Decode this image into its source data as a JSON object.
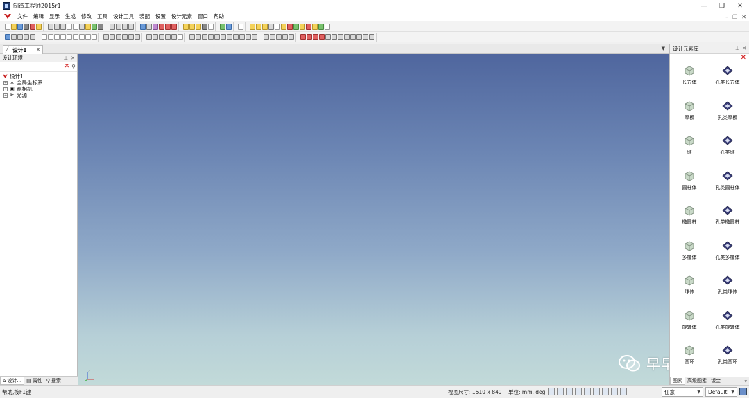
{
  "window": {
    "title": "制造工程师2015r1"
  },
  "menu": {
    "items": [
      "文件",
      "编辑",
      "显示",
      "生成",
      "修改",
      "工具",
      "设计工具",
      "装配",
      "设置",
      "设计元素",
      "窗口",
      "帮助"
    ]
  },
  "document_tab": {
    "label": "设计1"
  },
  "left_panel": {
    "title": "设计环境",
    "tree": [
      {
        "label": "设计1"
      },
      {
        "label": "全局坐标系"
      },
      {
        "label": "照相机"
      },
      {
        "label": "光源"
      }
    ],
    "bottom_tabs": [
      "设计...",
      "属性",
      "搜索"
    ]
  },
  "right_panel": {
    "title": "设计元素库",
    "items": [
      {
        "label": "长方体",
        "icon": "box-icon"
      },
      {
        "label": "孔类长方体",
        "icon": "hole-box-icon"
      },
      {
        "label": "厚板",
        "icon": "plate-icon"
      },
      {
        "label": "孔类厚板",
        "icon": "hole-plate-icon"
      },
      {
        "label": "键",
        "icon": "key-icon"
      },
      {
        "label": "孔类键",
        "icon": "hole-key-icon"
      },
      {
        "label": "圆柱体",
        "icon": "cylinder-icon"
      },
      {
        "label": "孔类圆柱体",
        "icon": "hole-cylinder-icon"
      },
      {
        "label": "椭圆柱",
        "icon": "elliptic-cylinder-icon"
      },
      {
        "label": "孔类椭圆柱",
        "icon": "hole-elliptic-cylinder-icon"
      },
      {
        "label": "多棱体",
        "icon": "prism-icon"
      },
      {
        "label": "孔类多棱体",
        "icon": "hole-prism-icon"
      },
      {
        "label": "球体",
        "icon": "sphere-icon"
      },
      {
        "label": "孔类球体",
        "icon": "hole-sphere-icon"
      },
      {
        "label": "旋转体",
        "icon": "revolve-icon"
      },
      {
        "label": "孔类旋转体",
        "icon": "hole-revolve-icon"
      },
      {
        "label": "圆环",
        "icon": "torus-icon"
      },
      {
        "label": "孔类圆环",
        "icon": "hole-torus-icon"
      }
    ],
    "bottom_tabs": [
      "图素",
      "高级图素",
      "钣金"
    ]
  },
  "status": {
    "help": "帮助,按F1键",
    "view_size": "视图尺寸: 1510 x 849",
    "units": "单位: mm, deg",
    "select_any": "任意",
    "select_default": "Default"
  },
  "watermark": {
    "text": "早早软件"
  },
  "colors": {
    "viewport_top": "#4f669e",
    "viewport_bottom": "#c2dad9",
    "close_red": "#d01010"
  }
}
